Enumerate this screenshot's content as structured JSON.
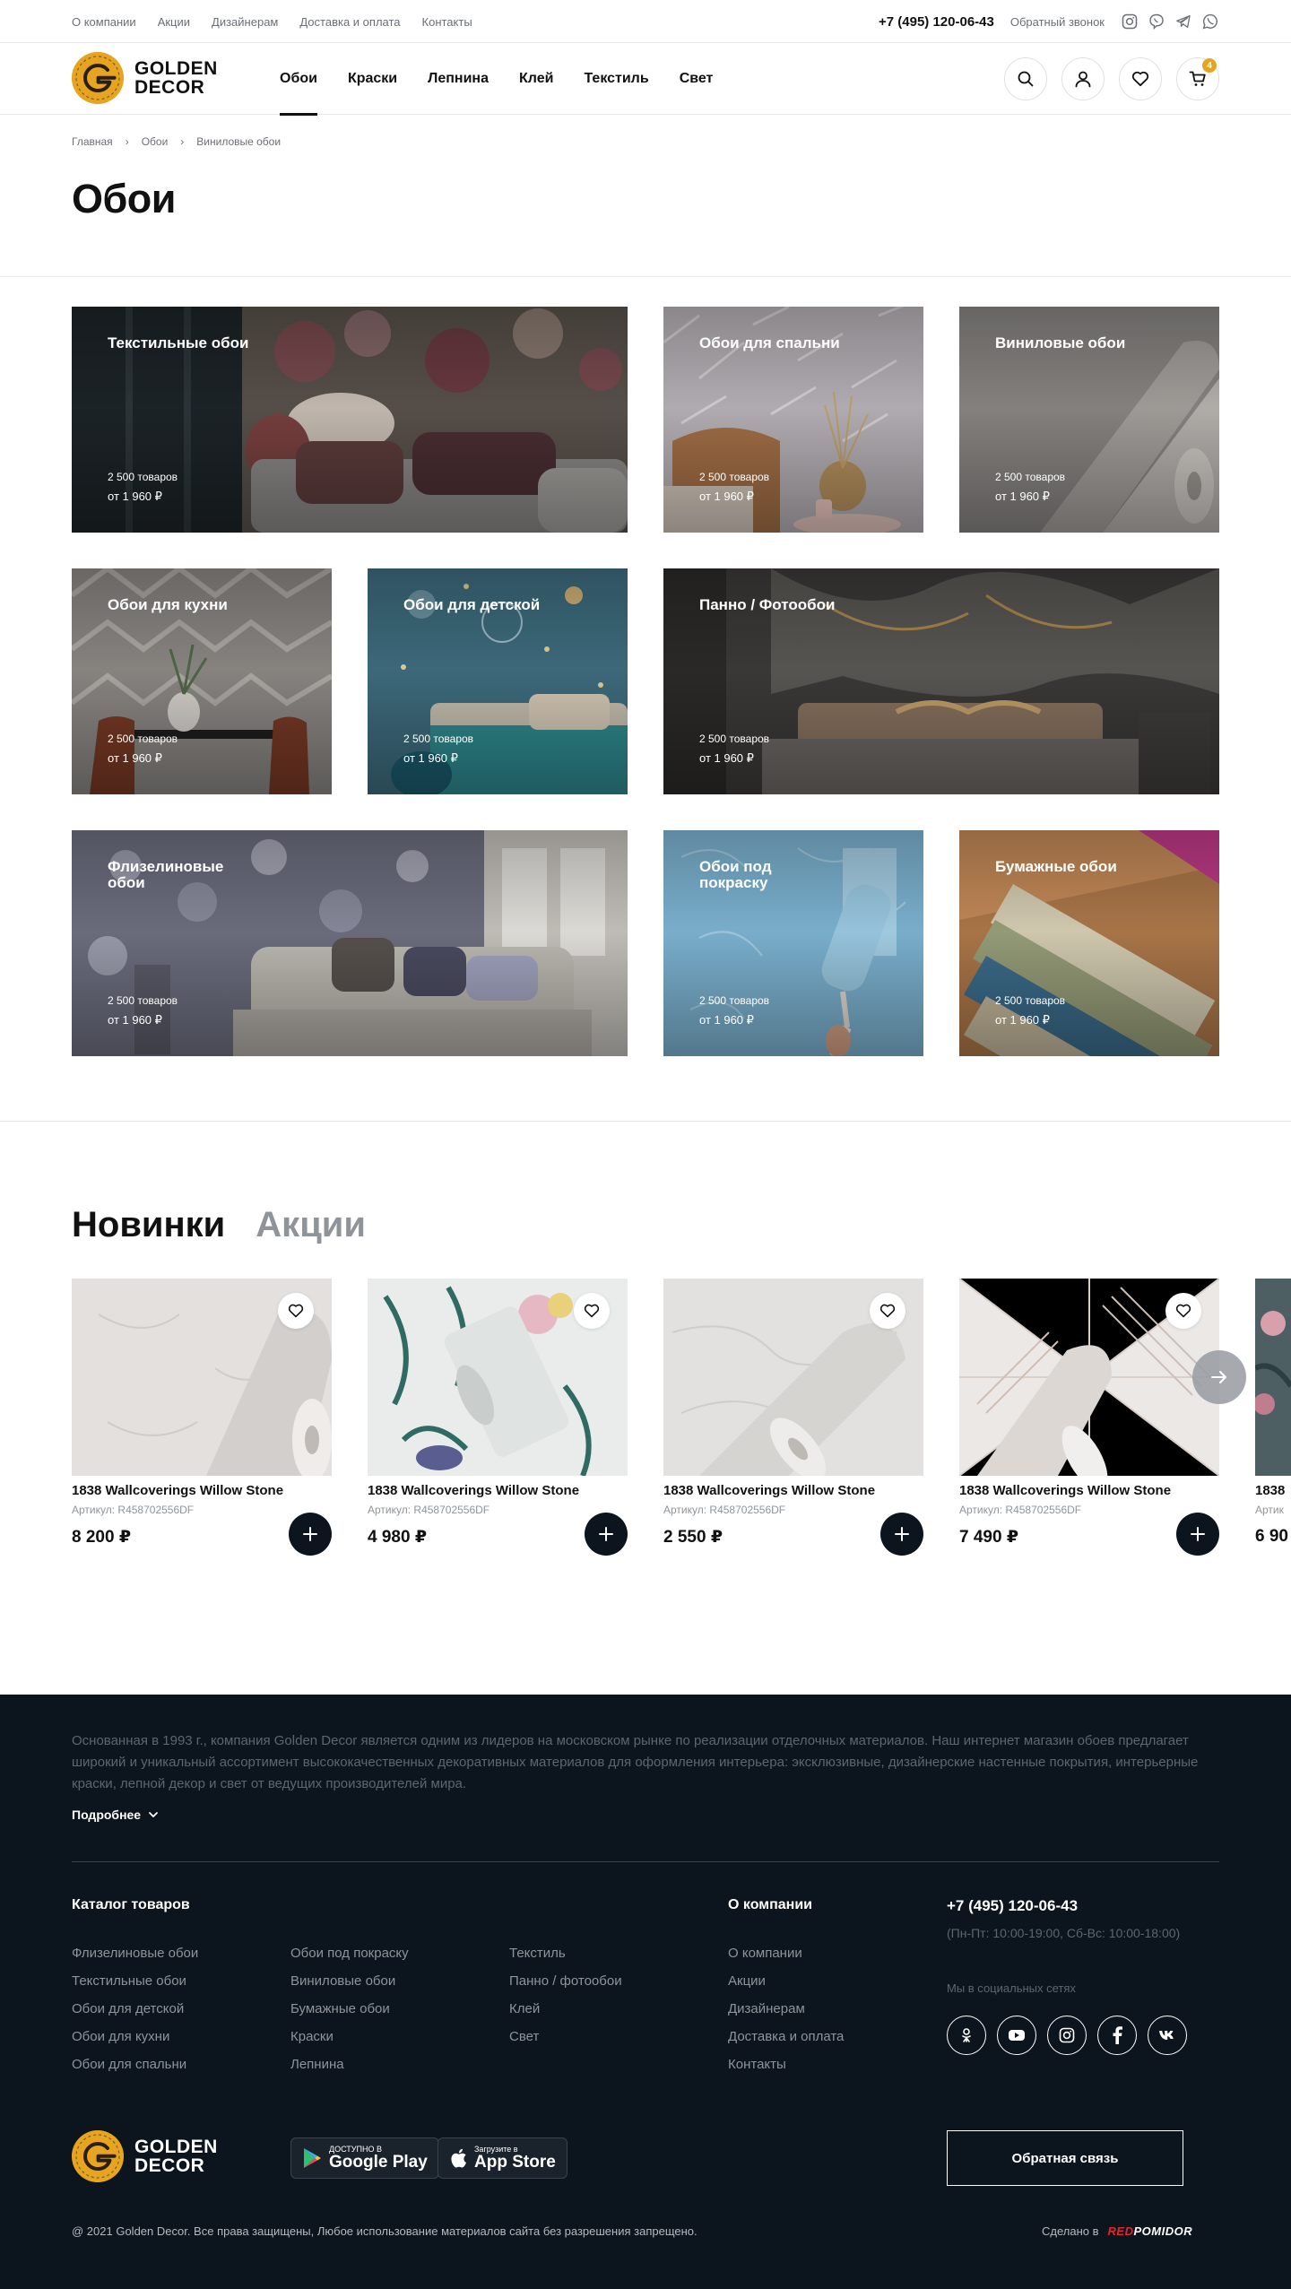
{
  "topbar": {
    "links": [
      "О компании",
      "Акции",
      "Дизайнерам",
      "Доставка и оплата",
      "Контакты"
    ],
    "phone": "+7 (495) 120-06-43",
    "callback": "Обратный звонок",
    "social_icons": [
      "instagram-icon",
      "viber-icon",
      "telegram-icon",
      "whatsapp-icon"
    ]
  },
  "header": {
    "logo_line1": "GOLDEN",
    "logo_line2": "DECOR",
    "nav": [
      "Обои",
      "Краски",
      "Лепнина",
      "Клей",
      "Текстиль",
      "Свет"
    ],
    "active_nav": "Обои",
    "cart_count": "4",
    "icons": [
      "search-icon",
      "user-icon",
      "heart-icon",
      "cart-icon"
    ]
  },
  "breadcrumb": [
    "Главная",
    "Обои",
    "Виниловые обои"
  ],
  "page_title": "Обои",
  "categories": [
    {
      "title": "Текстильные обои",
      "count": "2 500 товаров",
      "price": "от 1 960 ₽"
    },
    {
      "title": "Обои для спальни",
      "count": "2 500 товаров",
      "price": "от 1 960 ₽"
    },
    {
      "title": "Виниловые обои",
      "count": "2 500 товаров",
      "price": "от 1 960 ₽"
    },
    {
      "title": "Обои для кухни",
      "count": "2 500 товаров",
      "price": "от 1 960 ₽"
    },
    {
      "title": "Обои для детской",
      "count": "2 500 товаров",
      "price": "от 1 960 ₽"
    },
    {
      "title": "Панно / Фотообои",
      "count": "2 500 товаров",
      "price": "от 1 960 ₽"
    },
    {
      "title": "Флизелиновые обои",
      "count": "2 500 товаров",
      "price": "от 1 960 ₽"
    },
    {
      "title": "Обои под покраску",
      "count": "2 500 товаров",
      "price": "от 1 960 ₽"
    },
    {
      "title": "Бумажные обои",
      "count": "2 500 товаров",
      "price": "от 1 960 ₽"
    }
  ],
  "section_tabs": {
    "active": "Новинки",
    "inactive": "Акции"
  },
  "products": [
    {
      "name": "1838 Wallcoverings Willow Stone",
      "sku": "Артикул: R458702556DF",
      "price": "8 200 ₽"
    },
    {
      "name": "1838 Wallcoverings Willow Stone",
      "sku": "Артикул: R458702556DF",
      "price": "4 980 ₽"
    },
    {
      "name": "1838 Wallcoverings Willow Stone",
      "sku": "Артикул: R458702556DF",
      "price": "2 550 ₽"
    },
    {
      "name": "1838 Wallcoverings Willow Stone",
      "sku": "Артикул: R458702556DF",
      "price": "7 490 ₽"
    },
    {
      "name": "1838",
      "sku": "Артик",
      "price": "6 90"
    }
  ],
  "footer": {
    "about": "Основанная в 1993 г., компания Golden Decor является одним из лидеров на московском рынке по реализации отделочных материалов. Наш интернет магазин обоев предлагает широкий и уникальный ассортимент высококачественных декоративных материалов для оформления интерьера: эксклюзивные, дизайнерские настенные покрытия, интерьерные краски, лепной декор и свет от ведущих производителей мира.",
    "more": "Подробнее",
    "catalog_title": "Каталог товаров",
    "catalog_col1": [
      "Флизелиновые обои",
      "Текстильные обои",
      "Обои для детской",
      "Обои для кухни",
      "Обои для спальни"
    ],
    "catalog_col2": [
      "Обои под покраску",
      "Виниловые обои",
      "Бумажные обои",
      "Краски",
      "Лепнина"
    ],
    "catalog_col3": [
      "Текстиль",
      "Панно / фотообои",
      "Клей",
      "Свет"
    ],
    "company_title": "О компании",
    "company_links": [
      "О компании",
      "Акции",
      "Дизайнерам",
      "Доставка и оплата",
      "Контакты"
    ],
    "phone": "+7 (495) 120-06-43",
    "hours": "(Пн-Пт: 10:00-19:00, Сб-Вс: 10:00-18:00)",
    "social_label": "Мы в социальных сетях",
    "social_icons": [
      "odnoklassniki-icon",
      "youtube-icon",
      "instagram-icon",
      "facebook-icon",
      "vk-icon"
    ],
    "google_small": "ДОСТУПНО В",
    "google_big": "Google Play",
    "apple_small": "Загрузите в",
    "apple_big": "App Store",
    "feedback": "Обратная связь",
    "copyright": "@ 2021 Golden Decor. Все права защищены, Любое использование материалов сайта без разрешения запрещено.",
    "made_by": "Сделано в",
    "made_red": "RED",
    "made_white": "POMIDOR"
  },
  "colors": {
    "accent": "#e7a421",
    "footer_bg": "#0c141d",
    "made_red": "#e3242b"
  }
}
